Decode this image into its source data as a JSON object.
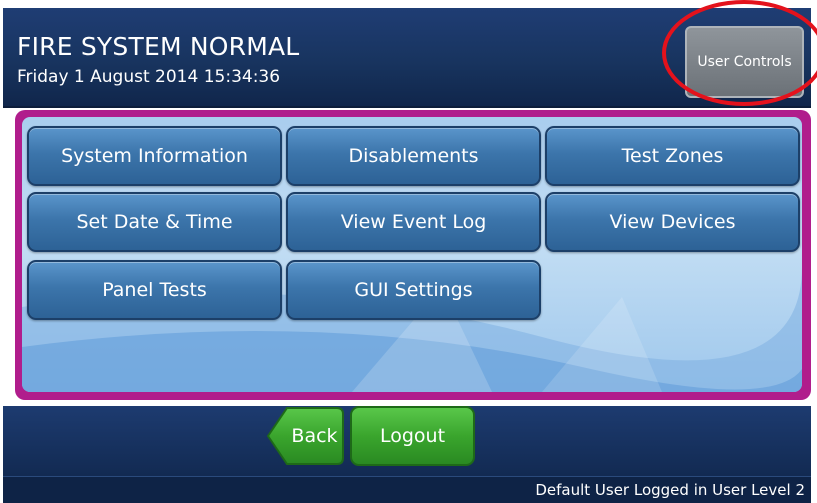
{
  "header": {
    "status_title": "FIRE SYSTEM NORMAL",
    "datetime": "Friday 1 August 2014 15:34:36",
    "user_controls_label": "User Controls"
  },
  "menu": {
    "buttons": [
      "System Information",
      "Disablements",
      "Test Zones",
      "Set Date & Time",
      "View Event Log",
      "View Devices",
      "Panel Tests",
      "GUI Settings"
    ]
  },
  "footer": {
    "back_label": "Back",
    "logout_label": "Logout",
    "login_status": "Default User Logged in User Level 2"
  },
  "colors": {
    "header_blue": "#18345f",
    "panel_magenta": "#b01d8c",
    "button_blue": "#3c75ab",
    "button_green": "#3aa52d",
    "highlight_red": "#e4121c"
  }
}
